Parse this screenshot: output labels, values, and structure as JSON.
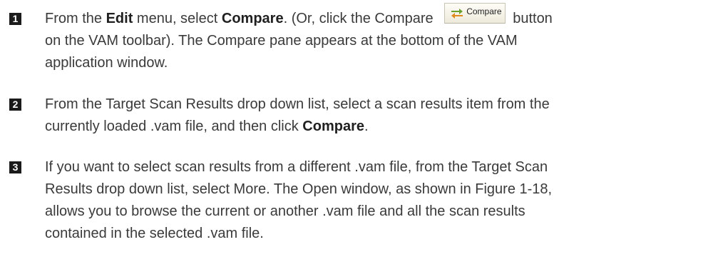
{
  "steps": [
    {
      "number": "1",
      "lines": {
        "a1": "From the ",
        "a2": "Edit",
        "a3": " menu, select ",
        "a4": "Compare",
        "a5": ". (Or, click the Compare ",
        "a6": "button",
        "b": "on the VAM toolbar). The Compare pane appears at the bottom of the VAM",
        "c": "application window."
      },
      "toolbar_button": {
        "label": "Compare",
        "icon": "compare-arrows-icon",
        "colors": {
          "arrow_green": "#6aa02c",
          "arrow_orange": "#e08a1e"
        }
      }
    },
    {
      "number": "2",
      "lines": {
        "a": "From the Target Scan Results drop down list, select a scan results item from the",
        "b1": "currently loaded .vam file, and then click ",
        "b2": "Compare",
        "b3": "."
      }
    },
    {
      "number": "3",
      "lines": {
        "a": "If you want to select scan results from a different .vam file, from the Target Scan",
        "b": "Results drop down list, select More. The Open window, as shown in Figure 1-18,",
        "c": "allows you to browse the current or another .vam file and all the scan results",
        "d": "contained in the selected .vam file."
      }
    }
  ],
  "colors": {
    "text": "#3a3a3a",
    "step_badge_bg": "#1b1b1b",
    "step_badge_fg": "#ffffff"
  }
}
